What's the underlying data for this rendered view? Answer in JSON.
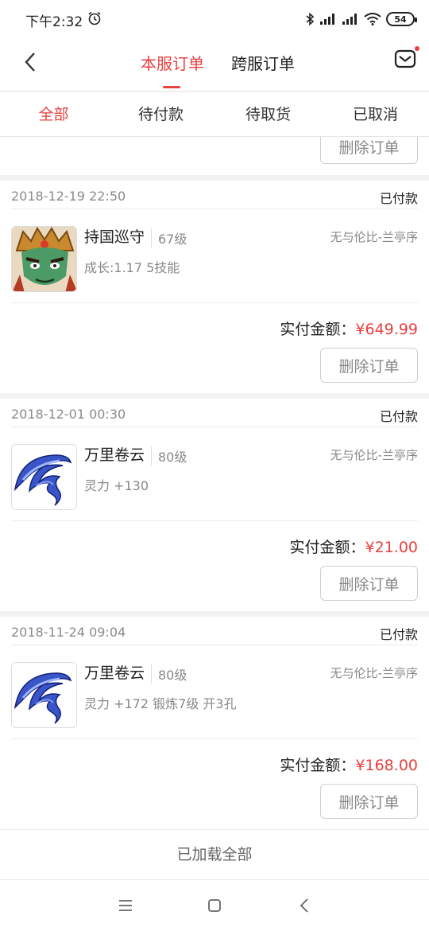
{
  "status_bar": {
    "time": "下午2:32",
    "battery": "54"
  },
  "header": {
    "tabs": [
      {
        "label": "本服订单"
      },
      {
        "label": "跨服订单"
      }
    ],
    "active_tab": 0
  },
  "filters": [
    {
      "label": "全部"
    },
    {
      "label": "待付款"
    },
    {
      "label": "待取货"
    },
    {
      "label": "已取消"
    }
  ],
  "delete_label": "删除订单",
  "paid_label": "实付金额：",
  "orders": [
    {
      "time": "2018-12-19 22:50",
      "status": "已付款",
      "name": "持国巡守",
      "level": "67级",
      "server": "无与伦比-兰亭序",
      "desc": "成长:1.17 5技能",
      "amount": "¥649.99",
      "thumb_icon": "guardian-character-icon"
    },
    {
      "time": "2018-12-01 00:30",
      "status": "已付款",
      "name": "万里卷云",
      "level": "80级",
      "server": "无与伦比-兰亭序",
      "desc": "灵力 +130",
      "amount": "¥21.00",
      "thumb_icon": "blue-ribbon-item-icon"
    },
    {
      "time": "2018-11-24 09:04",
      "status": "已付款",
      "name": "万里卷云",
      "level": "80级",
      "server": "无与伦比-兰亭序",
      "desc": "灵力 +172 锻炼7级 开3孔",
      "amount": "¥168.00",
      "thumb_icon": "blue-ribbon-item-icon"
    }
  ],
  "footer_text": "已加载全部",
  "colors": {
    "accent": "#e94040"
  }
}
